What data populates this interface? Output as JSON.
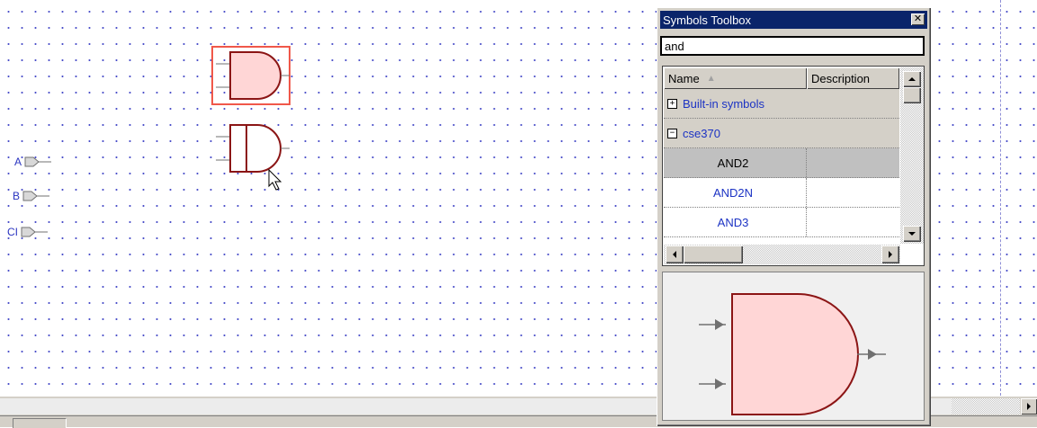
{
  "canvas": {
    "pins": [
      {
        "label": "A"
      },
      {
        "label": "B"
      },
      {
        "label": "CI"
      }
    ]
  },
  "toolbox": {
    "title": "Symbols Toolbox",
    "close_glyph": "✕",
    "search_value": "and",
    "columns": {
      "name": "Name",
      "description": "Description"
    },
    "sort_icon": "▲",
    "groups": [
      {
        "label": "Built-in symbols",
        "expander": "+"
      },
      {
        "label": "cse370",
        "expander": "−"
      }
    ],
    "items": [
      {
        "name": "AND2",
        "selected": true
      },
      {
        "name": "AND2N",
        "selected": false
      },
      {
        "name": "AND3",
        "selected": false
      }
    ]
  },
  "colors": {
    "gate_fill": "#ffd6d6",
    "gate_stroke": "#8b1515",
    "selection": "#f0584a",
    "pin_text": "#2a34c0",
    "title_bar": "#0a246a"
  },
  "icons": [
    "and-gate-icon",
    "input-pin-icon",
    "arrow-cursor-icon",
    "close-icon",
    "scroll-arrow-icon"
  ]
}
